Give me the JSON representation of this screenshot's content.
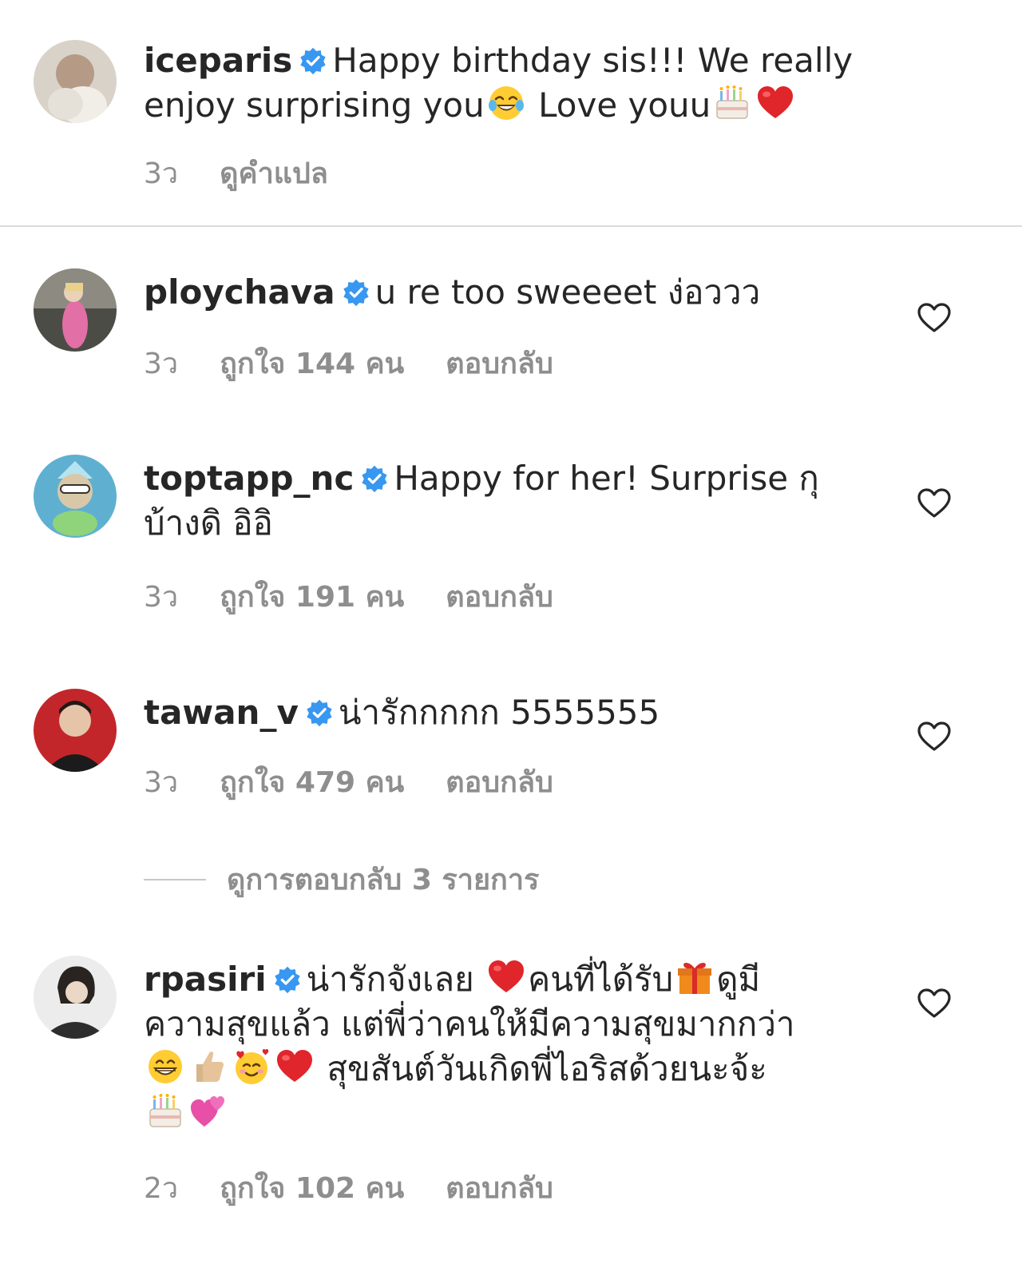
{
  "comments": [
    {
      "username": "iceparis",
      "text1": "Happy birthday sis!!! We really",
      "text2": "enjoy surprising you",
      "text3": " Love youu",
      "time": "3ว",
      "translate": "ดูคำแปล",
      "emoji": [
        "face-with-tears-of-joy-icon",
        "birthday-cake-icon",
        "red-heart-icon"
      ]
    },
    {
      "username": "ploychava",
      "text": "u re too sweeeet ง่อววว",
      "time": "3ว",
      "likes": "ถูกใจ 144 คน",
      "reply": "ตอบกลับ"
    },
    {
      "username": "toptapp_nc",
      "text1": "Happy for her! Surprise กุ",
      "text2": "บ้างดิ อิอิ",
      "time": "3ว",
      "likes": "ถูกใจ 191 คน",
      "reply": "ตอบกลับ"
    },
    {
      "username": "tawan_v",
      "text": "น่ารักกกกก 5555555",
      "time": "3ว",
      "likes": "ถูกใจ 479 คน",
      "reply": "ตอบกลับ",
      "view_replies": "ดูการตอบกลับ 3 รายการ"
    },
    {
      "username": "rpasiri",
      "text1a": "น่ารักจังเลย",
      "text1b": "คนที่ได้รับ",
      "text1c": "ดูมี",
      "text2": "ความสุขแล้ว แต่พี่ว่าคนให้มีความสุขมากกว่า",
      "text3": "สุขสันต์วันเกิดพี่ไอริสด้วยนะจ้ะ",
      "time": "2ว",
      "likes": "ถูกใจ 102 คน",
      "reply": "ตอบกลับ",
      "emoji": [
        "red-heart-icon",
        "wrapped-gift-icon",
        "grinning-face-icon",
        "thumbs-up-icon",
        "smiling-face-with-hearts-icon",
        "red-heart-icon",
        "birthday-cake-icon",
        "two-hearts-icon"
      ]
    }
  ],
  "colors": {
    "text": "#262626",
    "secondary": "#8e8e8e",
    "verified": "#3897f0",
    "divider": "#dbdbdb"
  }
}
